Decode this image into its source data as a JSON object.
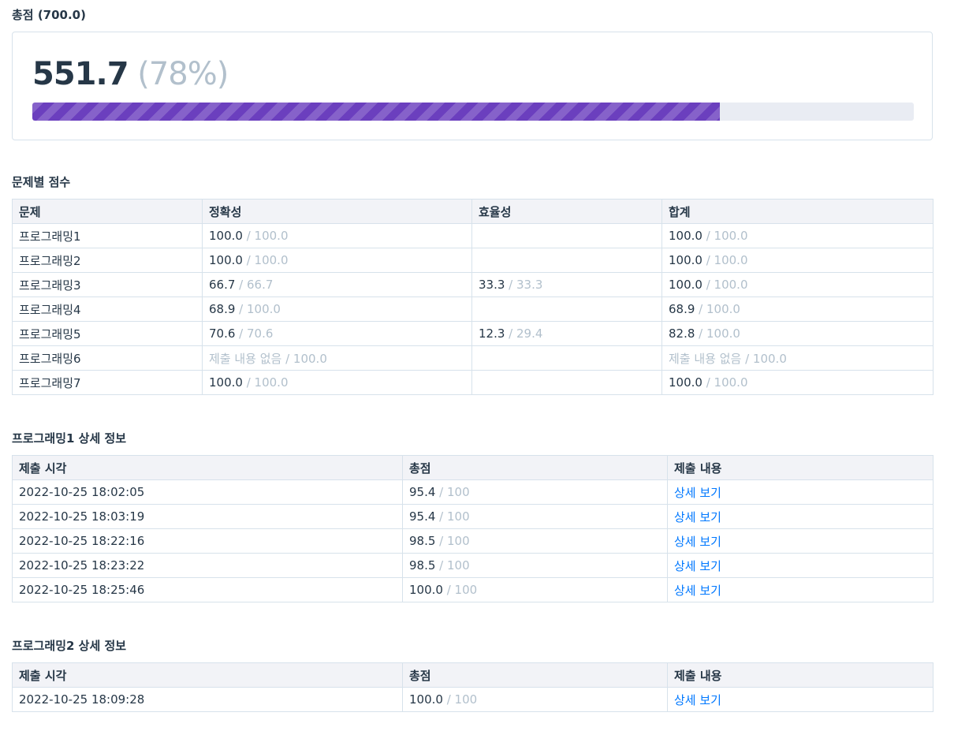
{
  "summary": {
    "title": "총점 (700.0)",
    "score": "551.7",
    "percent": "(78%)",
    "progress_fraction": 0.78,
    "bar_color": "#6b3fbe"
  },
  "problem_scores": {
    "title": "문제별 점수",
    "headers": [
      "문제",
      "정확성",
      "효율성",
      "합계"
    ],
    "rows": [
      {
        "name": "프로그래밍1",
        "acc": "100.0",
        "acc_max": " / 100.0",
        "eff": "",
        "eff_max": "",
        "sum": "100.0",
        "sum_max": " / 100.0"
      },
      {
        "name": "프로그래밍2",
        "acc": "100.0",
        "acc_max": " / 100.0",
        "eff": "",
        "eff_max": "",
        "sum": "100.0",
        "sum_max": " / 100.0"
      },
      {
        "name": "프로그래밍3",
        "acc": "66.7",
        "acc_max": " / 66.7",
        "eff": "33.3",
        "eff_max": " / 33.3",
        "sum": "100.0",
        "sum_max": " / 100.0"
      },
      {
        "name": "프로그래밍4",
        "acc": "68.9",
        "acc_max": " / 100.0",
        "eff": "",
        "eff_max": "",
        "sum": "68.9",
        "sum_max": " / 100.0"
      },
      {
        "name": "프로그래밍5",
        "acc": "70.6",
        "acc_max": " / 70.6",
        "eff": "12.3",
        "eff_max": " / 29.4",
        "sum": "82.8",
        "sum_max": " / 100.0"
      },
      {
        "name": "프로그래밍6",
        "acc": "",
        "acc_max": "제출 내용 없음 / 100.0",
        "eff": "",
        "eff_max": "",
        "sum": "",
        "sum_max": "제출 내용 없음 / 100.0"
      },
      {
        "name": "프로그래밍7",
        "acc": "100.0",
        "acc_max": " / 100.0",
        "eff": "",
        "eff_max": "",
        "sum": "100.0",
        "sum_max": " / 100.0"
      }
    ]
  },
  "detail1": {
    "title": "프로그래밍1 상세 정보",
    "headers": [
      "제출 시각",
      "총점",
      "제출 내용"
    ],
    "rows": [
      {
        "time": "2022-10-25 18:02:05",
        "score": "95.4",
        "max": " / 100",
        "link": "상세 보기"
      },
      {
        "time": "2022-10-25 18:03:19",
        "score": "95.4",
        "max": " / 100",
        "link": "상세 보기"
      },
      {
        "time": "2022-10-25 18:22:16",
        "score": "98.5",
        "max": " / 100",
        "link": "상세 보기"
      },
      {
        "time": "2022-10-25 18:23:22",
        "score": "98.5",
        "max": " / 100",
        "link": "상세 보기"
      },
      {
        "time": "2022-10-25 18:25:46",
        "score": "100.0",
        "max": " / 100",
        "link": "상세 보기"
      }
    ]
  },
  "detail2": {
    "title": "프로그래밍2 상세 정보",
    "headers": [
      "제출 시각",
      "총점",
      "제출 내용"
    ],
    "rows": [
      {
        "time": "2022-10-25 18:09:28",
        "score": "100.0",
        "max": " / 100",
        "link": "상세 보기"
      }
    ]
  }
}
